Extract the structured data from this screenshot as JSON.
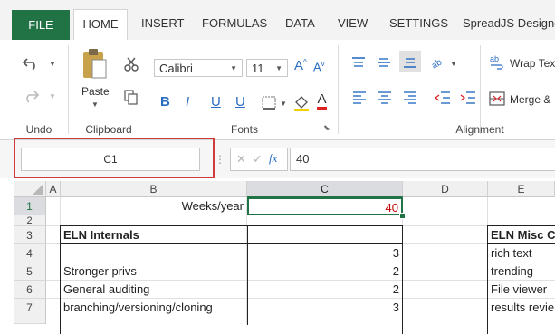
{
  "tabs": {
    "file": "FILE",
    "home": "HOME",
    "insert": "INSERT",
    "formulas": "FORMULAS",
    "data": "DATA",
    "view": "VIEW",
    "settings": "SETTINGS",
    "designer": "SpreadJS Designe"
  },
  "ribbon": {
    "undo_group": "Undo",
    "clipboard_group": "Clipboard",
    "paste_label": "Paste",
    "fonts_group": "Fonts",
    "font_name": "Calibri",
    "font_size": "11",
    "bold": "B",
    "italic": "I",
    "underline": "U",
    "double_underline": "U",
    "font_color_glyph": "A",
    "alignment_group": "Alignment",
    "wrap_text": "Wrap Text",
    "merge": "Merge &"
  },
  "formula_bar": {
    "name_box": "C1",
    "fx": "fx",
    "value": "40"
  },
  "columns": [
    "A",
    "B",
    "C",
    "D",
    "E"
  ],
  "rows": [
    "1",
    "2",
    "3",
    "4",
    "5",
    "6",
    "7"
  ],
  "cells": {
    "B1": "Weeks/year",
    "C1": "40",
    "B3": "ELN Internals",
    "C4": "3",
    "B5": "Stronger privs",
    "C5": "2",
    "B6": "General auditing",
    "C6": "2",
    "B7": "branching/versioning/cloning",
    "C7": "3",
    "E3": "ELN Misc Co",
    "E4": "rich text",
    "E5": "trending",
    "E6": "File viewer",
    "E7": "results revie"
  },
  "colors": {
    "file_tab": "#217346",
    "selection": "#217346",
    "highlight_box": "#d03c3c",
    "accent_blue": "#2a6ec3",
    "value_red": "#c00000"
  }
}
